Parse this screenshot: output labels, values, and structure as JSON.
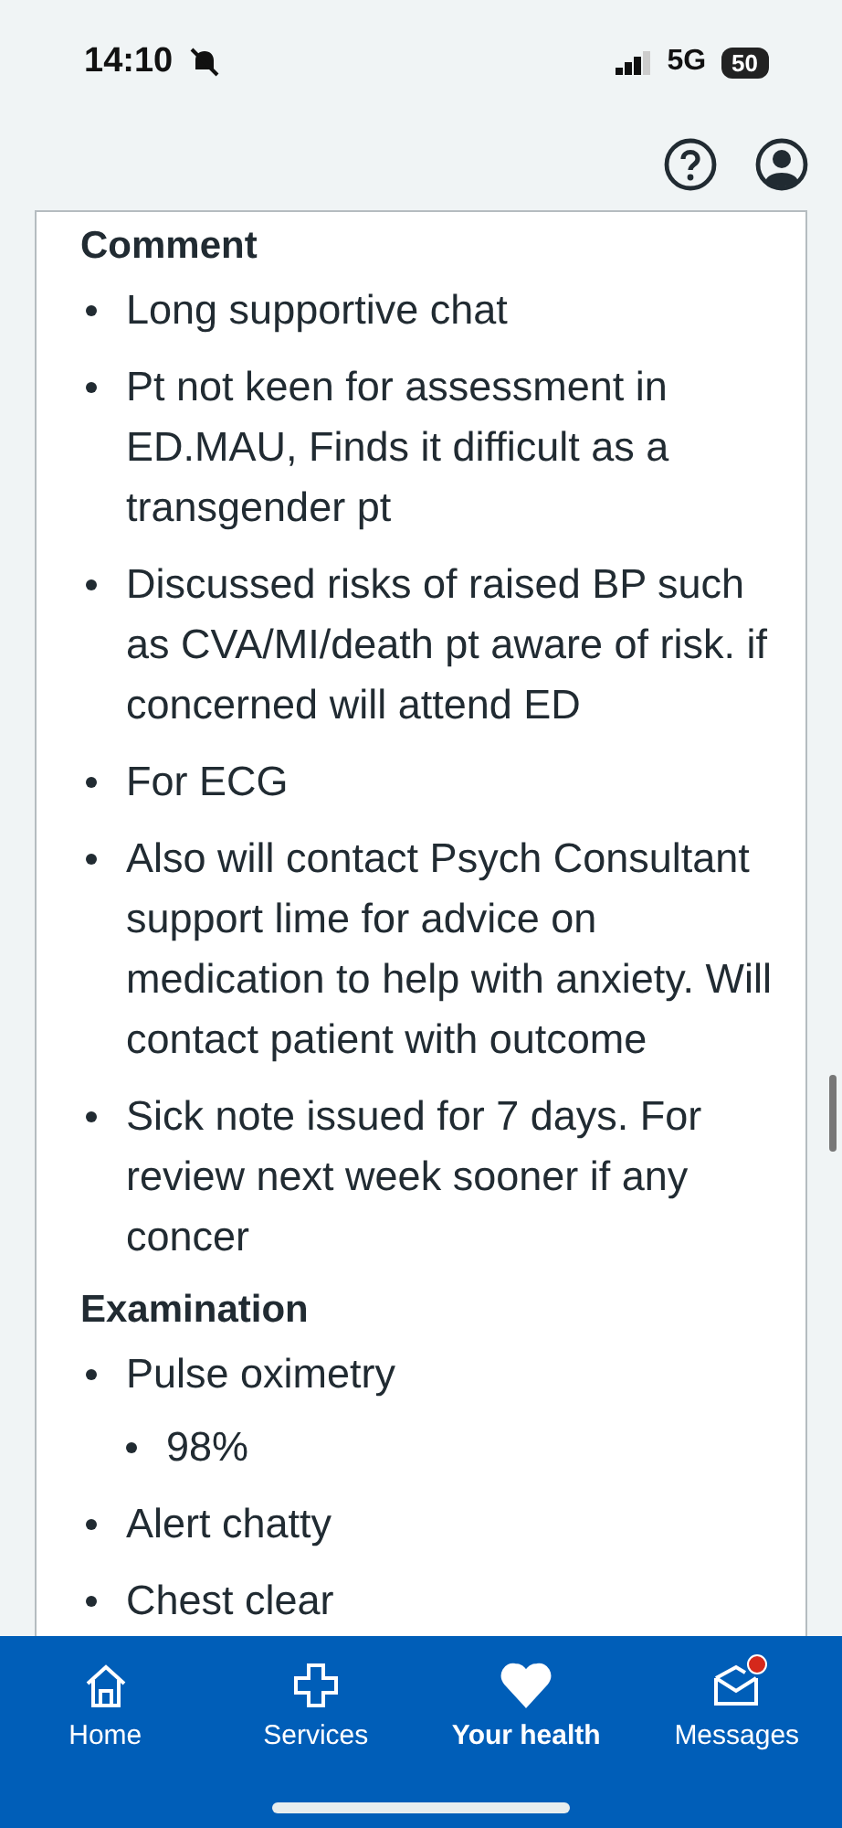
{
  "status_bar": {
    "time": "14:10",
    "network": "5G",
    "battery": "50"
  },
  "sections": [
    {
      "heading": "Comment",
      "items": [
        {
          "text": "Long supportive chat"
        },
        {
          "text": "Pt not keen for assessment in ED.MAU, Finds it difficult as a transgender pt"
        },
        {
          "text": "Discussed risks of raised BP such as CVA/MI/death pt aware of risk. if concerned will attend ED"
        },
        {
          "text": "For ECG"
        },
        {
          "text": "Also will contact Psych Consultant support lime for advice on medication to help with anxiety. Will contact patient with outcome"
        },
        {
          "text": "Sick note issued for 7 days. For review next week sooner if any concer"
        }
      ]
    },
    {
      "heading": "Examination",
      "items": [
        {
          "text": "Pulse oximetry",
          "children": [
            {
              "text": "98%"
            }
          ]
        },
        {
          "text": "Alert chatty"
        },
        {
          "text": "Chest clear"
        }
      ]
    }
  ],
  "nav": [
    {
      "label": "Home",
      "selected": false,
      "unread": false
    },
    {
      "label": "Services",
      "selected": false,
      "unread": false
    },
    {
      "label": "Your health",
      "selected": true,
      "unread": false
    },
    {
      "label": "Messages",
      "selected": false,
      "unread": true
    }
  ]
}
